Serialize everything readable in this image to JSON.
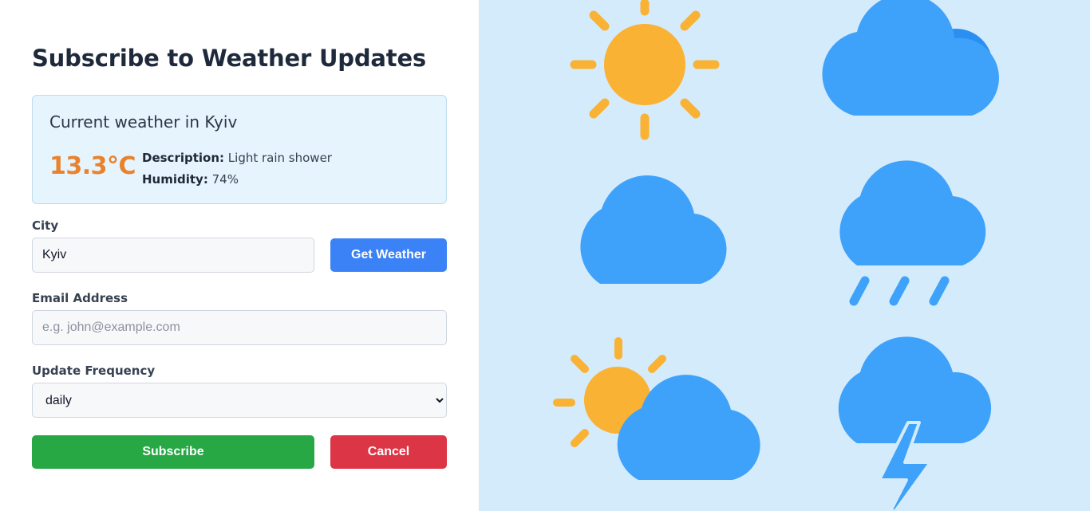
{
  "form": {
    "title": "Subscribe to Weather Updates",
    "weather_card": {
      "heading": "Current weather in Kyiv",
      "temperature": "13.3°C",
      "description_label": "Description:",
      "description_value": "Light rain shower",
      "humidity_label": "Humidity:",
      "humidity_value": "74%"
    },
    "city": {
      "label": "City",
      "value": "Kyiv"
    },
    "get_weather_label": "Get Weather",
    "email": {
      "label": "Email Address",
      "value": "",
      "placeholder": "e.g. john@example.com"
    },
    "frequency": {
      "label": "Update Frequency",
      "selected": "daily"
    },
    "subscribe_label": "Subscribe",
    "cancel_label": "Cancel"
  },
  "illustration": {
    "icons": [
      "sun-icon",
      "cloud-icon",
      "cloud-icon",
      "rain-cloud-icon",
      "partly-cloudy-icon",
      "thunderstorm-icon"
    ]
  },
  "colors": {
    "panel_bg": "#d4ebfb",
    "sun": "#f9b233",
    "cloud": "#3ea2fb",
    "temperature": "#e9822c",
    "primary_button": "#3b82f6",
    "subscribe_button": "#28a745",
    "cancel_button": "#dc3545"
  }
}
